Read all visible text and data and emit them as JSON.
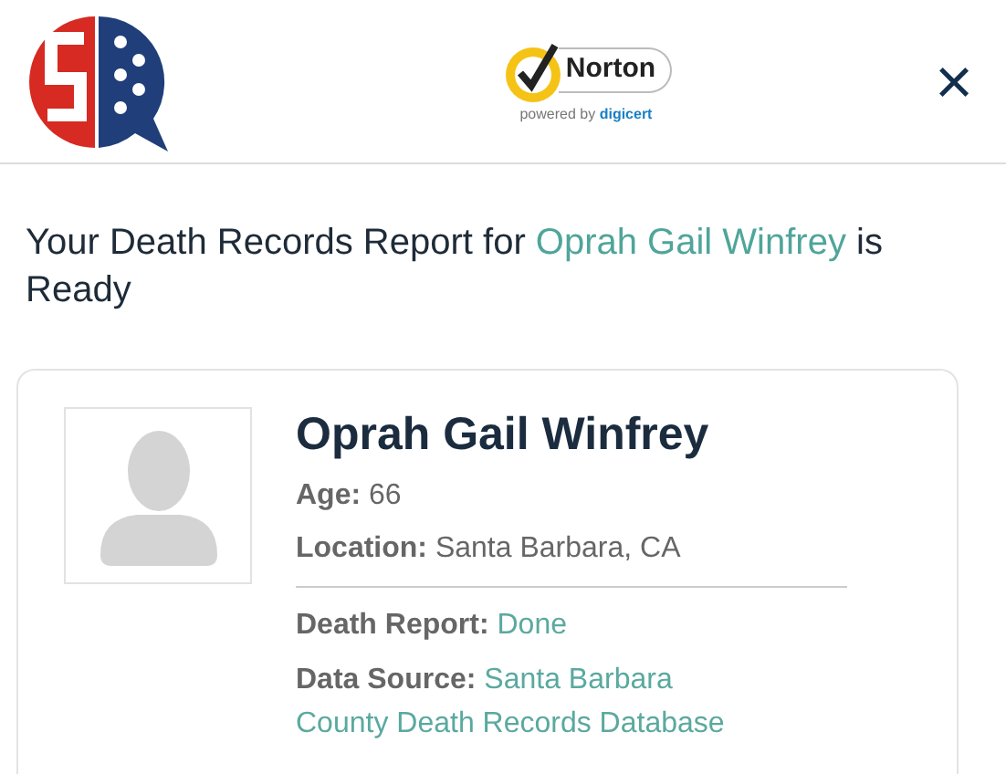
{
  "header": {
    "seal": {
      "brand": "Norton",
      "tagline_prefix": "powered by",
      "tagline_brand": "digicert"
    },
    "close": "×"
  },
  "heading": {
    "prefix": "Your Death Records Report for",
    "name": "Oprah Gail Winfrey",
    "suffix": "is Ready"
  },
  "card": {
    "name": "Oprah Gail Winfrey",
    "details": [
      {
        "label": "Age:",
        "value": "66"
      },
      {
        "label": "Location:",
        "value": "Santa Barbara, CA"
      }
    ],
    "report": [
      {
        "label": "Death Report:",
        "value": "Done"
      },
      {
        "label": "Data Source:",
        "value_lines": [
          "Santa Barbara",
          "County Death Records Database"
        ]
      }
    ]
  }
}
